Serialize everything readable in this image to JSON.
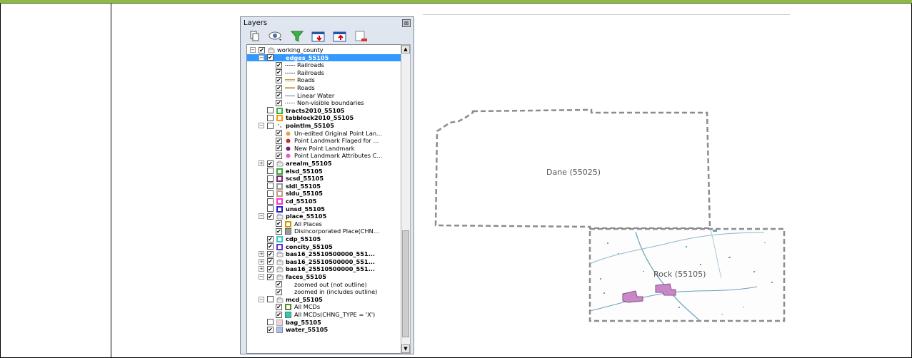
{
  "panel": {
    "title": "Layers",
    "close_glyph": "⊠",
    "toolbar": [
      "add-group-icon",
      "visibility-eye-icon",
      "filter-funnel-icon",
      "expand-all-icon",
      "collapse-all-icon",
      "remove-layer-icon"
    ]
  },
  "tree": [
    {
      "indent": 0,
      "exp": "-",
      "cb": true,
      "sym": "group",
      "label": "working_county",
      "bold": false
    },
    {
      "indent": 1,
      "exp": "-",
      "cb": true,
      "sym": "none",
      "label": "edges_55105",
      "bold": true,
      "selected": true
    },
    {
      "indent": 2,
      "cb": true,
      "sym": "rail",
      "label": "Railroads"
    },
    {
      "indent": 2,
      "cb": true,
      "sym": "rail2",
      "label": "Railroads"
    },
    {
      "indent": 2,
      "cb": true,
      "sym": "road",
      "label": "Roads"
    },
    {
      "indent": 2,
      "cb": true,
      "sym": "road2",
      "label": "Roads"
    },
    {
      "indent": 2,
      "cb": true,
      "sym": "water",
      "label": "Linear Water"
    },
    {
      "indent": 2,
      "cb": true,
      "sym": "dash",
      "label": "Non-visible boundaries"
    },
    {
      "indent": 1,
      "cb": false,
      "sym": "#3cb043",
      "label": "tracts2010_55105",
      "bold": true
    },
    {
      "indent": 1,
      "cb": false,
      "sym": "#ff9900",
      "label": "tabblock2010_55105",
      "bold": true
    },
    {
      "indent": 1,
      "exp": "-",
      "cb": false,
      "sym": "points",
      "label": "pointlm_55105",
      "bold": true
    },
    {
      "indent": 2,
      "cb": true,
      "sym": "pt-orange",
      "label": "Un-edited Original Point Lan..."
    },
    {
      "indent": 2,
      "cb": true,
      "sym": "pt-red",
      "label": "Point Landmark Flaged for ..."
    },
    {
      "indent": 2,
      "cb": true,
      "sym": "pt-purple",
      "label": "New Point Landmark"
    },
    {
      "indent": 2,
      "cb": true,
      "sym": "pt-pink",
      "label": "Point Landmark Attributes C..."
    },
    {
      "indent": 1,
      "exp": "+",
      "cb": true,
      "sym": "group",
      "label": "arealm_55105",
      "bold": true
    },
    {
      "indent": 1,
      "cb": false,
      "sym": "#33aa33",
      "label": "elsd_55105",
      "bold": true
    },
    {
      "indent": 1,
      "cb": false,
      "sym": "#7a2a7a",
      "label": "scsd_55105",
      "bold": true
    },
    {
      "indent": 1,
      "cb": false,
      "sym": "#999999",
      "label": "sldl_55105",
      "bold": true
    },
    {
      "indent": 1,
      "cb": false,
      "sym": "#c0a080",
      "label": "sldu_55105",
      "bold": true
    },
    {
      "indent": 1,
      "cb": false,
      "sym": "#ff33cc",
      "label": "cd_55105",
      "bold": true
    },
    {
      "indent": 1,
      "cb": false,
      "sym": "#2222cc",
      "label": "unsd_55105",
      "bold": true
    },
    {
      "indent": 1,
      "exp": "-",
      "cb": true,
      "sym": "group",
      "label": "place_55105",
      "bold": true
    },
    {
      "indent": 2,
      "cb": true,
      "sym": "#cc9900",
      "label": "All Places"
    },
    {
      "indent": 2,
      "cb": true,
      "sym": "fill-gray",
      "label": "Disincorporated Place(CHN..."
    },
    {
      "indent": 1,
      "cb": true,
      "sym": "#33cccc",
      "label": "cdp_55105",
      "bold": true
    },
    {
      "indent": 1,
      "cb": true,
      "sym": "#6633cc",
      "label": "concity_55105",
      "bold": true
    },
    {
      "indent": 1,
      "exp": "+",
      "cb": true,
      "sym": "group",
      "label": "bas16_25510500000_551...",
      "bold": true
    },
    {
      "indent": 1,
      "exp": "+",
      "cb": true,
      "sym": "group",
      "label": "bas16_25510500000_551...",
      "bold": true
    },
    {
      "indent": 1,
      "exp": "+",
      "cb": true,
      "sym": "group",
      "label": "bas16_25510500000_551...",
      "bold": true
    },
    {
      "indent": 1,
      "exp": "-",
      "cb": true,
      "sym": "group",
      "label": "faces_55105",
      "bold": true
    },
    {
      "indent": 2,
      "cb": true,
      "sym": "blank",
      "label": "zoomed out (not outline)"
    },
    {
      "indent": 2,
      "cb": true,
      "sym": "blank",
      "label": "zoomed in (includes outline)"
    },
    {
      "indent": 1,
      "exp": "-",
      "cb": false,
      "sym": "group",
      "label": "mcd_55105",
      "bold": true
    },
    {
      "indent": 2,
      "cb": true,
      "sym": "#558b2f",
      "label": "All MCDs"
    },
    {
      "indent": 2,
      "cb": true,
      "sym": "fill-cyan",
      "label": "All MCDs(CHNG_TYPE = 'X')"
    },
    {
      "indent": 1,
      "cb": false,
      "sym": "fill-pink",
      "label": "bag_55105",
      "bold": true
    },
    {
      "indent": 1,
      "cb": true,
      "sym": "fill-lightblue",
      "label": "water_55105",
      "bold": true
    }
  ],
  "map": {
    "labels": {
      "dane": "Dane (55025)",
      "rock": "Rock (55105)"
    }
  }
}
